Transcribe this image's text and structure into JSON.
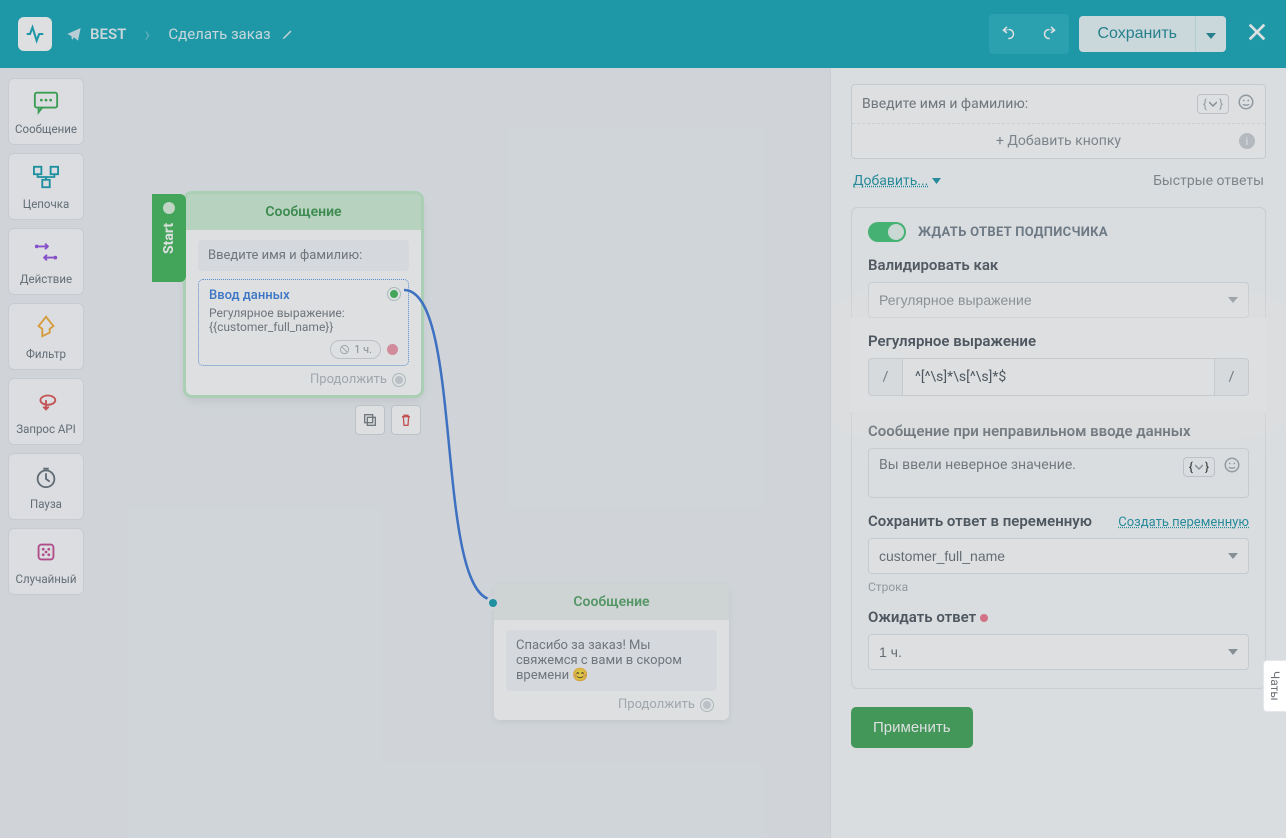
{
  "header": {
    "bot_name": "BEST",
    "flow_title": "Сделать заказ",
    "save_label": "Сохранить"
  },
  "sidebar": {
    "items": [
      {
        "label": "Сообщение"
      },
      {
        "label": "Цепочка"
      },
      {
        "label": "Действие"
      },
      {
        "label": "Фильтр"
      },
      {
        "label": "Запрос API"
      },
      {
        "label": "Пауза"
      },
      {
        "label": "Случайный"
      }
    ]
  },
  "canvas": {
    "start_label": "Start",
    "node1": {
      "title": "Сообщение",
      "text": "Введите имя и фамилию:",
      "data_entry_title": "Ввод данных",
      "data_entry_sub": "Регулярное выражение:",
      "data_entry_var": "{{customer_full_name}}",
      "timer": "1 ч.",
      "continue_label": "Продолжить"
    },
    "node2": {
      "title": "Сообщение",
      "text": "Спасибо за заказ! Мы свяжемся с вами в скором времени 😊",
      "continue_label": "Продолжить"
    }
  },
  "panel": {
    "prompt_text": "Введите имя и фамилию:",
    "add_button_label": "+ Добавить кнопку",
    "add_link": "Добавить...",
    "quick_replies_label": "Быстрые ответы",
    "wait_response_label": "ЖДАТЬ ОТВЕТ ПОДПИСЧИКА",
    "validate_as_label": "Валидировать как",
    "validate_as_value": "Регулярное выражение",
    "regex_label": "Регулярное выражение",
    "regex_value": "^[^\\s]*\\s[^\\s]*$",
    "error_message_label": "Сообщение при неправильном вводе данных",
    "error_message_value": "Вы ввели неверное значение.",
    "save_var_label": "Сохранить ответ в переменную",
    "create_var_link": "Создать переменную",
    "save_var_value": "customer_full_name",
    "var_type_hint": "Строка",
    "wait_answer_label": "Ожидать ответ",
    "wait_answer_value": "1 ч.",
    "apply_label": "Применить",
    "chat_tab": "Чаты"
  }
}
